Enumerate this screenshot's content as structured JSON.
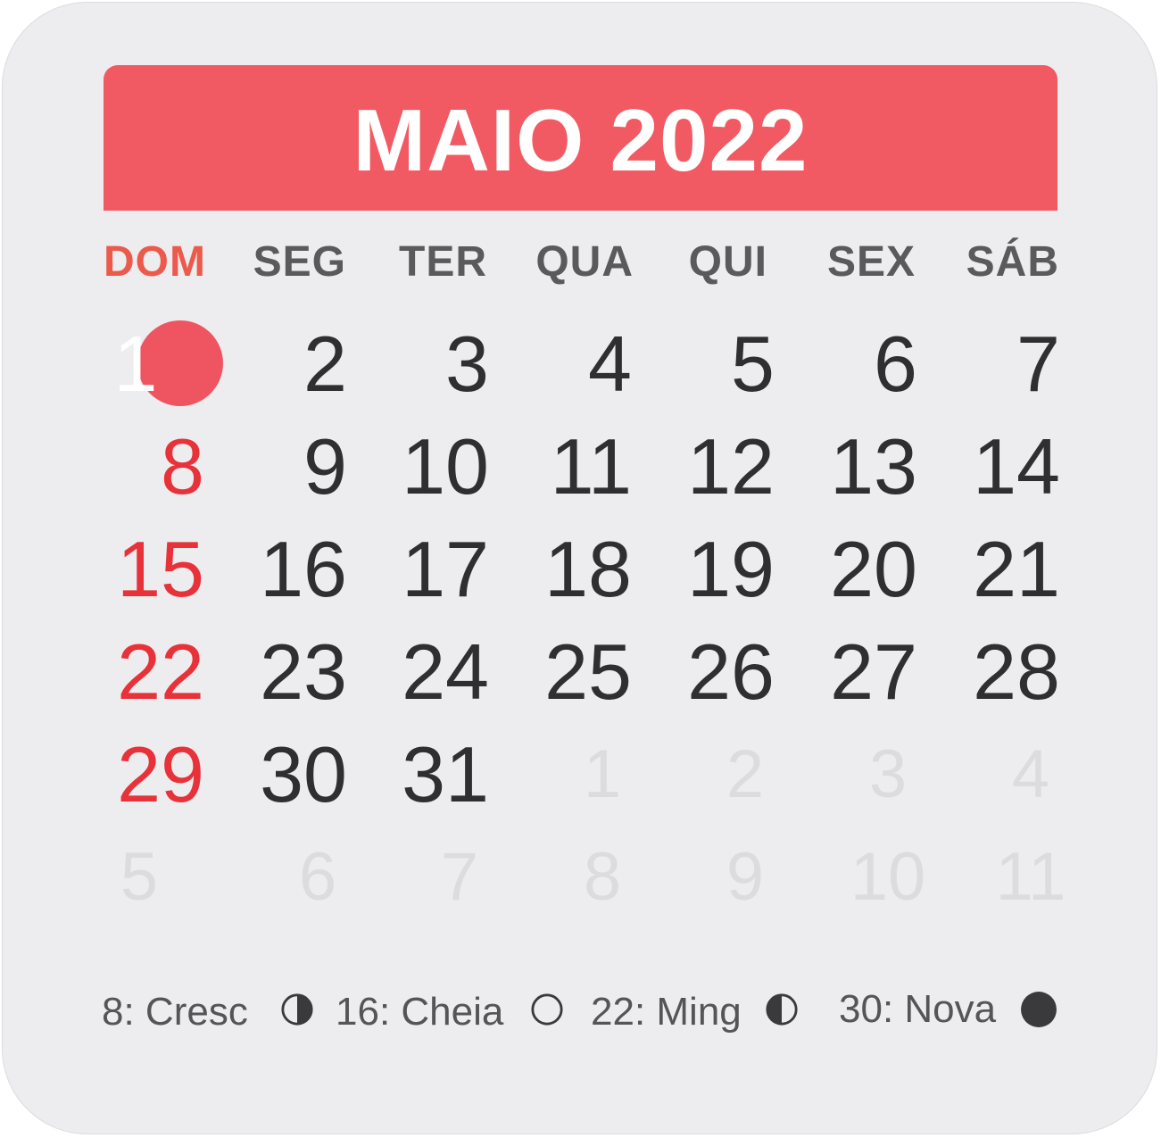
{
  "calendar": {
    "title": "MAIO 2022",
    "weekdays": [
      "DOM",
      "SEG",
      "TER",
      "QUA",
      "QUI",
      "SEX",
      "SÁB"
    ],
    "weeks": [
      [
        "1",
        "2",
        "3",
        "4",
        "5",
        "6",
        "7"
      ],
      [
        "8",
        "9",
        "10",
        "11",
        "12",
        "13",
        "14"
      ],
      [
        "15",
        "16",
        "17",
        "18",
        "19",
        "20",
        "21"
      ],
      [
        "22",
        "23",
        "24",
        "25",
        "26",
        "27",
        "28"
      ],
      [
        "29",
        "30",
        "31",
        "1",
        "2",
        "3",
        "4"
      ],
      [
        "5",
        "6",
        "7",
        "8",
        "9",
        "10",
        "11"
      ]
    ],
    "highlighted_day": "1"
  },
  "moon_phases": [
    {
      "label": "8: Cresc",
      "icon": "first-quarter-moon-icon"
    },
    {
      "label": "16: Cheia",
      "icon": "full-moon-icon"
    },
    {
      "label": "22: Ming",
      "icon": "last-quarter-moon-icon"
    },
    {
      "label": "30: Nova",
      "icon": "new-moon-icon"
    }
  ],
  "colors": {
    "header": "#f15a62",
    "sunday": "#e8323a",
    "text": "#2f2f31",
    "faded": "#dcdcde",
    "background": "#ededef"
  }
}
